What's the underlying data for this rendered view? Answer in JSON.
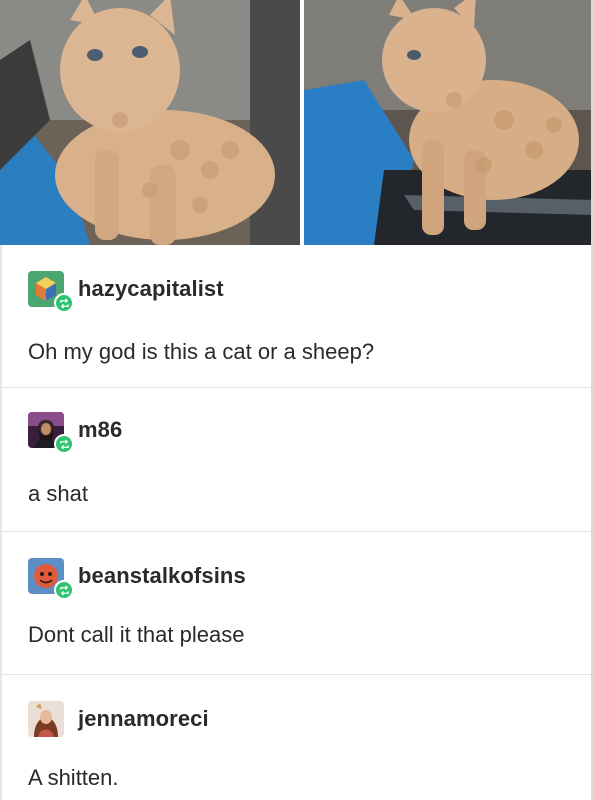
{
  "photos": [
    {
      "name": "curly-kitten-photo-1"
    },
    {
      "name": "curly-kitten-photo-2"
    }
  ],
  "posts": [
    {
      "username": "hazycapitalist",
      "text": "Oh my god is this a cat or a sheep?",
      "avatar": "cube-avatar"
    },
    {
      "username": "m86",
      "text": "a shat",
      "avatar": "person-avatar"
    },
    {
      "username": "beanstalkofsins",
      "text": "Dont call it that please",
      "avatar": "circle-face-avatar"
    },
    {
      "username": "jennamoreci",
      "text": "A shitten.",
      "avatar": "portrait-avatar"
    }
  ],
  "colors": {
    "reblog_badge": "#2fc46f",
    "divider": "#e3e3e3",
    "text": "#2a2a2a"
  }
}
